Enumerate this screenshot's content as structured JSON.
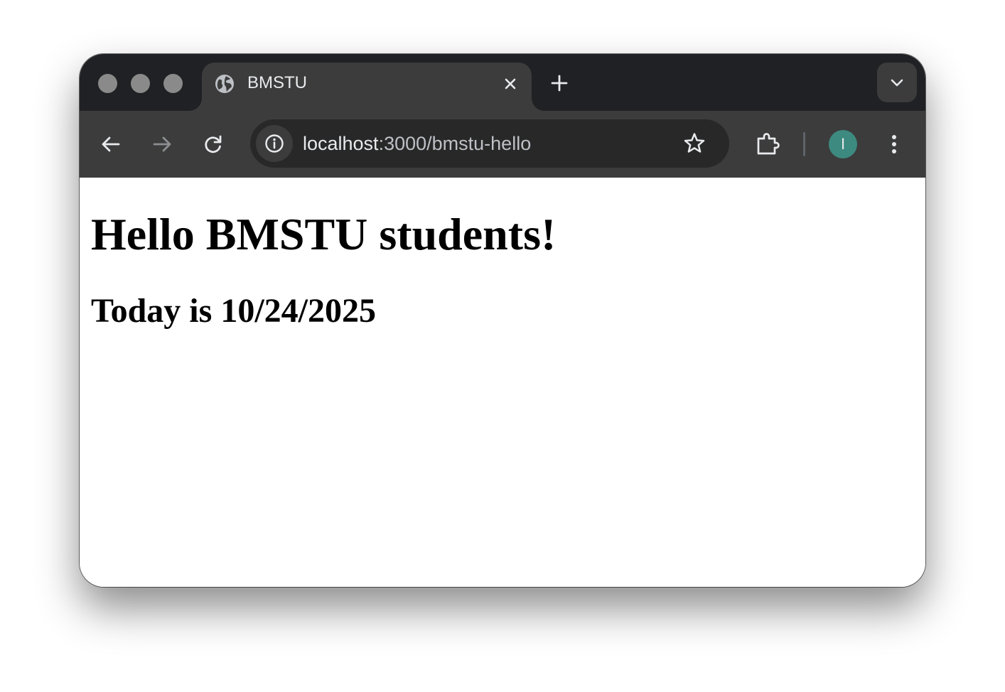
{
  "tab": {
    "title": "BMSTU"
  },
  "address_bar": {
    "url_host": "localhost",
    "url_rest": ":3000/bmstu-hello"
  },
  "profile": {
    "initial": "I",
    "color": "#3d8a80"
  },
  "page": {
    "heading": "Hello BMSTU students!",
    "subheading": "Today is 10/24/2025"
  },
  "icons": {
    "tab_favicon": "globe-icon",
    "tab_close": "close-icon",
    "new_tab": "plus-icon",
    "tab_search": "chevron-down-icon",
    "back": "arrow-left-icon",
    "forward": "arrow-right-icon",
    "reload": "reload-icon",
    "site_info": "info-icon",
    "bookmark": "star-icon",
    "extensions": "puzzle-icon",
    "menu": "kebab-menu-icon"
  },
  "colors": {
    "tabstrip": "#202124",
    "toolbar": "#3c3c3c",
    "omnibox": "#282828"
  }
}
